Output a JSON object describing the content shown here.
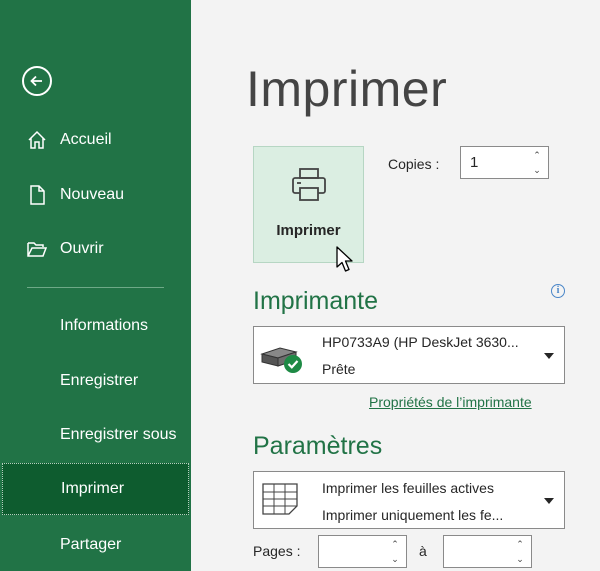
{
  "sidebar": {
    "back_icon": "arrow-left-circle-icon",
    "items": [
      {
        "label": "Accueil",
        "icon": "home-icon"
      },
      {
        "label": "Nouveau",
        "icon": "new-file-icon"
      },
      {
        "label": "Ouvrir",
        "icon": "folder-open-icon"
      },
      {
        "label": "Informations"
      },
      {
        "label": "Enregistrer"
      },
      {
        "label": "Enregistrer sous"
      },
      {
        "label": "Imprimer",
        "active": true
      },
      {
        "label": "Partager"
      }
    ]
  },
  "main": {
    "title": "Imprimer",
    "print_button": {
      "label": "Imprimer",
      "icon": "printer-icon"
    },
    "copies": {
      "label": "Copies :",
      "value": "1"
    },
    "printer_section": {
      "title": "Imprimante",
      "printer_name": "HP0733A9 (HP DeskJet 3630...",
      "status": "Prête",
      "properties_link": "Propriétés de l’imprimante",
      "info_icon": "info-icon"
    },
    "settings_section": {
      "title": "Paramètres",
      "print_scope": {
        "line1": "Imprimer les feuilles actives",
        "line2": "Imprimer uniquement les fe..."
      },
      "pages": {
        "label": "Pages :",
        "separator": "à",
        "from": "",
        "to": ""
      }
    }
  },
  "colors": {
    "accent": "#217346",
    "sidebar_active": "#0e5c2f",
    "background": "#f3f3f3"
  }
}
